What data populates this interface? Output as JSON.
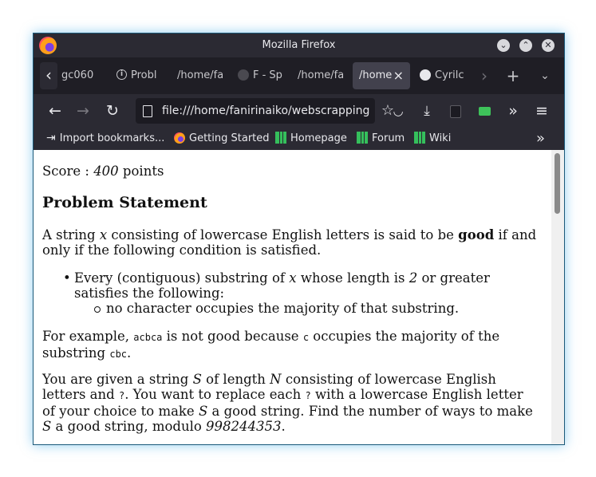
{
  "window": {
    "title": "Mozilla Firefox"
  },
  "window_controls": {
    "minimize": "⌄",
    "maximize": "⌃",
    "close": "✕"
  },
  "tabs": [
    {
      "label": "gc060"
    },
    {
      "label": "Probl"
    },
    {
      "label": "/home/fa"
    },
    {
      "label": "F - Sp"
    },
    {
      "label": "/home/fa"
    },
    {
      "label": "/home"
    },
    {
      "label": "Cyrilc"
    }
  ],
  "toolbar": {
    "url": "file:///home/fanirinaiko/webscrapping"
  },
  "bookmarks": [
    {
      "label": "Import bookmarks..."
    },
    {
      "label": "Getting Started"
    },
    {
      "label": "Homepage"
    },
    {
      "label": "Forum"
    },
    {
      "label": "Wiki"
    }
  ],
  "content": {
    "score_prefix": "Score : ",
    "score_value": "400",
    "score_suffix": " points",
    "heading": "Problem Statement",
    "p1_a": "A string ",
    "p1_x": "x",
    "p1_b": " consisting of lowercase English letters is said to be ",
    "p1_good": "good",
    "p1_c": " if and only if the following condition is satisfied.",
    "li1_a": "Every (contiguous) substring of ",
    "li1_x": "x",
    "li1_b": " whose length is ",
    "li1_2": "2",
    "li1_c": " or greater satisfies the following:",
    "li2": "no character occupies the majority of that substring.",
    "p2_a": "For example, ",
    "p2_code1": "acbca",
    "p2_b": " is not good because ",
    "p2_code2": "c",
    "p2_c": " occupies the majority of the substring ",
    "p2_code3": "cbc",
    "p2_d": ".",
    "p3_a": "You are given a string ",
    "p3_S": "S",
    "p3_b": " of length ",
    "p3_N": "N",
    "p3_c": " consisting of lowercase English letters and ",
    "p3_q1": "?",
    "p3_d": ". You want to replace each ",
    "p3_q2": "?",
    "p3_e": " with a lowercase English letter of your choice to make ",
    "p3_S2": "S",
    "p3_f": " a good string. Find the number of ways to make ",
    "p3_S3": "S",
    "p3_g": " a good string, modulo ",
    "p3_mod": "998244353",
    "p3_h": "."
  }
}
